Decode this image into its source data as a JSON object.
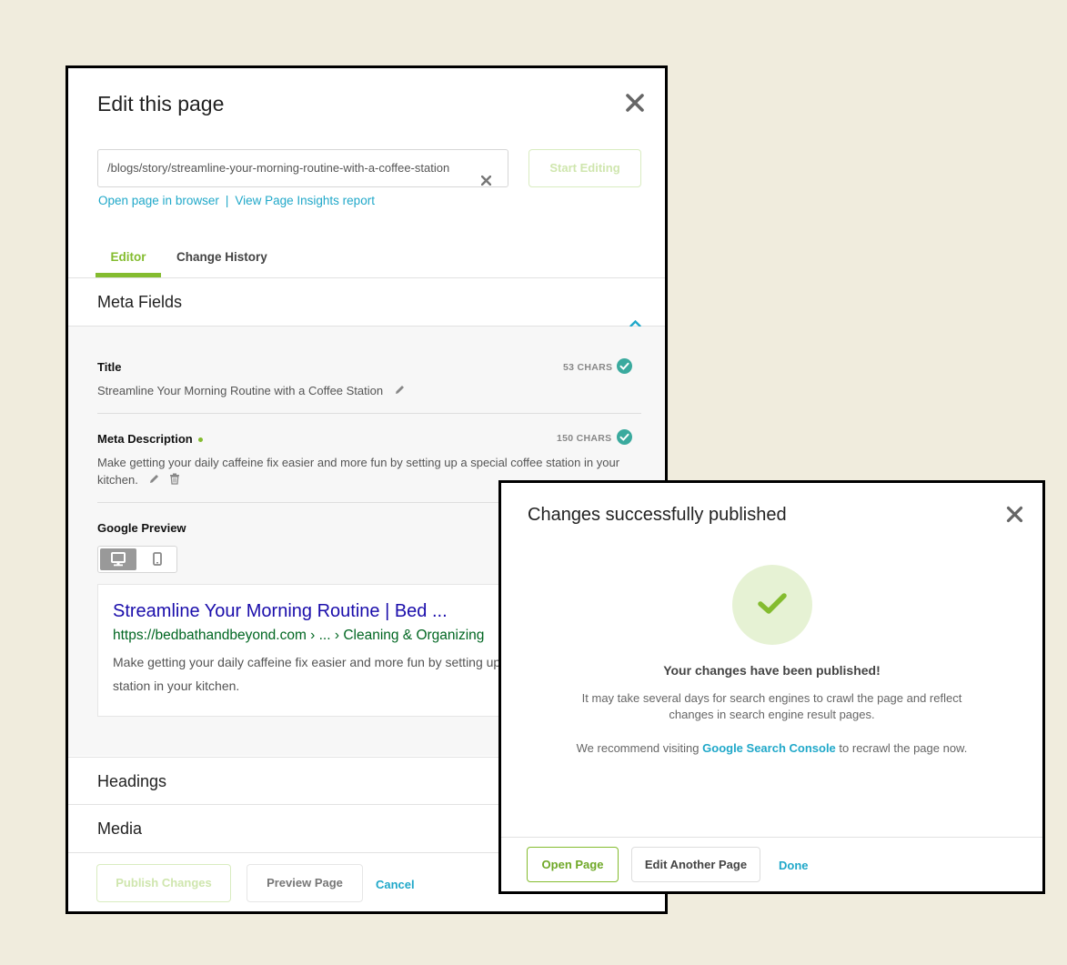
{
  "editor": {
    "title": "Edit this page",
    "url_value": "/blogs/story/streamline-your-morning-routine-with-a-coffee-station",
    "start_editing": "Start Editing",
    "link_open": "Open page in browser",
    "link_separator": "|",
    "link_insights": "View Page Insights report",
    "tabs": [
      {
        "label": "Editor",
        "active": true
      },
      {
        "label": "Change History",
        "active": false
      }
    ],
    "meta_fields": {
      "heading": "Meta Fields",
      "title_label": "Title",
      "title_chars": "53 CHARS",
      "title_value": "Streamline Your Morning Routine with a Coffee Station",
      "desc_label": "Meta Description",
      "desc_chars": "150 CHARS",
      "desc_value": "Make getting your daily caffeine fix easier and more fun by setting up a special coffee station in your kitchen.",
      "google_preview_label": "Google Preview",
      "preview": {
        "title": "Streamline Your Morning Routine | Bed ...",
        "url": "https://bedbathandbeyond.com › ... › Cleaning & Organizing",
        "description": "Make getting your daily caffeine fix easier and more fun by setting up a special coffee station in your kitchen."
      }
    },
    "headings_label": "Headings",
    "media_label": "Media",
    "buttons": {
      "publish": "Publish Changes",
      "preview": "Preview Page",
      "cancel": "Cancel"
    }
  },
  "modal": {
    "title": "Changes successfully published",
    "headline": "Your changes have been published!",
    "body": "It may take several days for search engines to crawl the page and reflect changes in search engine result pages.",
    "recommend_prefix": "We recommend visiting",
    "recommend_link": "Google Search Console",
    "recommend_suffix": "to recrawl the page now.",
    "buttons": {
      "open_page": "Open Page",
      "edit_another": "Edit Another Page",
      "done": "Done"
    }
  },
  "colors": {
    "accent_green": "#84bc2f",
    "link_teal": "#20a8c9",
    "check_teal": "#3aaa9e",
    "background": "#f0ecdd"
  }
}
